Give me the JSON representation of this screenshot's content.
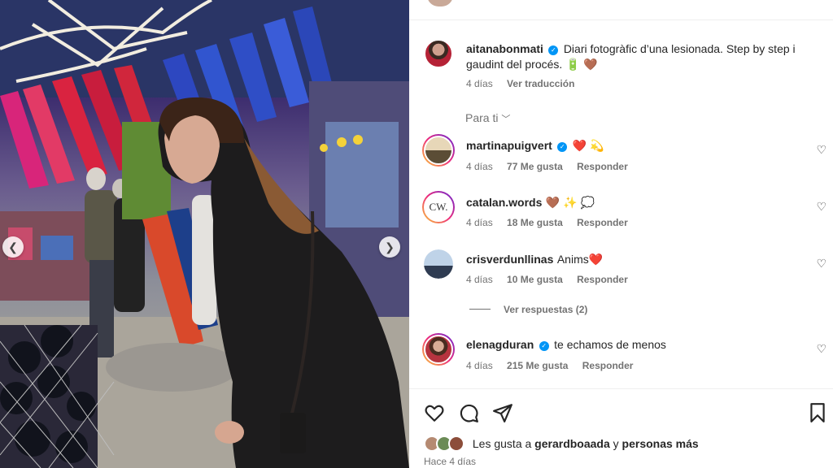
{
  "post": {
    "author": "aitanabonmati",
    "caption_line1": "Diari fotogràfic d’una lesionada. Step by step i",
    "caption_line2": "gaudint del procés.",
    "caption_emoji": "🔋 🤎",
    "age": "4 días",
    "translate": "Ver traducción"
  },
  "filter": {
    "label": "Para ti",
    "icon": "chevron-down-icon"
  },
  "comments": [
    {
      "user": "martinapuigvert",
      "verified": true,
      "text": "❤️ 💫",
      "age": "4 días",
      "likes": "77 Me gusta",
      "reply": "Responder"
    },
    {
      "user": "catalan.words",
      "verified": false,
      "text": "🤎 ✨ 💭",
      "age": "4 días",
      "likes": "18 Me gusta",
      "reply": "Responder",
      "avatar_text": "CW."
    },
    {
      "user": "crisverdunllinas",
      "verified": false,
      "text": "Anims❤️",
      "age": "4 días",
      "likes": "10 Me gusta",
      "reply": "Responder"
    },
    {
      "user": "elenagduran",
      "verified": true,
      "text": "te echamos de menos",
      "age": "4 días",
      "likes": "215 Me gusta",
      "reply": "Responder"
    }
  ],
  "view_replies": "Ver respuestas (2)",
  "likes_summary": {
    "prefix": "Les gusta a",
    "user": "gerardboaada",
    "joiner": "y",
    "others": "personas más"
  },
  "timestamp": "Hace 4 días",
  "colors": {
    "verified": "#0095f6",
    "muted": "#737373",
    "text": "#262626"
  }
}
